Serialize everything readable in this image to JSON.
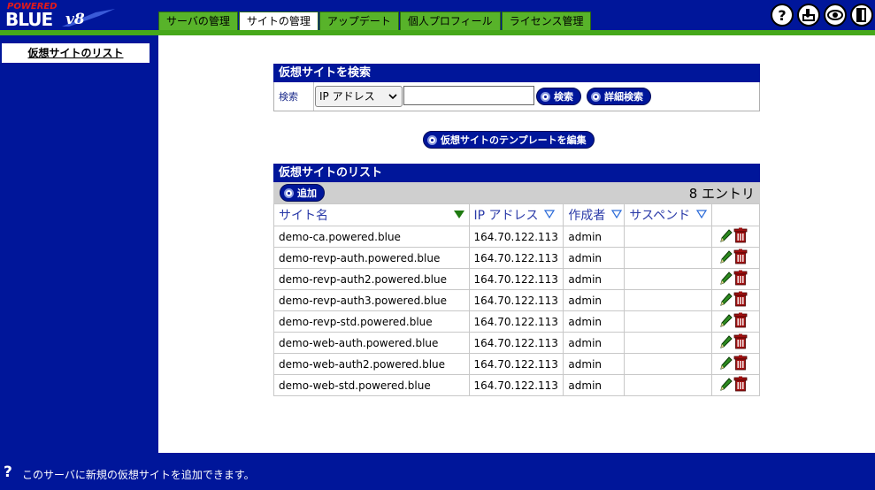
{
  "logo": {
    "powered": "POWERED",
    "blue": "BLUE",
    "version": "v8"
  },
  "tabs": [
    {
      "label": "サーバの管理",
      "active": false
    },
    {
      "label": "サイトの管理",
      "active": true
    },
    {
      "label": "アップデート",
      "active": false
    },
    {
      "label": "個人プロフィール",
      "active": false
    },
    {
      "label": "ライセンス管理",
      "active": false
    }
  ],
  "header_icons": [
    "help-icon",
    "download-icon",
    "view-icon",
    "logout-icon"
  ],
  "sidebar": {
    "items": [
      {
        "label": "仮想サイトのリスト"
      }
    ]
  },
  "search": {
    "title": "仮想サイトを検索",
    "label": "検索",
    "select_value": "IP アドレス",
    "input_value": "",
    "search_button": "検索",
    "advanced_button": "詳細検索"
  },
  "template_button": "仮想サイトのテンプレートを編集",
  "list": {
    "title": "仮想サイトのリスト",
    "add_button": "追加",
    "count_text": "8 エントリ",
    "columns": [
      "サイト名",
      "IP アドレス",
      "作成者",
      "サスペンド"
    ],
    "rows": [
      {
        "site": "demo-ca.powered.blue",
        "ip": "164.70.122.113",
        "creator": "admin",
        "suspend": ""
      },
      {
        "site": "demo-revp-auth.powered.blue",
        "ip": "164.70.122.113",
        "creator": "admin",
        "suspend": ""
      },
      {
        "site": "demo-revp-auth2.powered.blue",
        "ip": "164.70.122.113",
        "creator": "admin",
        "suspend": ""
      },
      {
        "site": "demo-revp-auth3.powered.blue",
        "ip": "164.70.122.113",
        "creator": "admin",
        "suspend": ""
      },
      {
        "site": "demo-revp-std.powered.blue",
        "ip": "164.70.122.113",
        "creator": "admin",
        "suspend": ""
      },
      {
        "site": "demo-web-auth.powered.blue",
        "ip": "164.70.122.113",
        "creator": "admin",
        "suspend": ""
      },
      {
        "site": "demo-web-auth2.powered.blue",
        "ip": "164.70.122.113",
        "creator": "admin",
        "suspend": ""
      },
      {
        "site": "demo-web-std.powered.blue",
        "ip": "164.70.122.113",
        "creator": "admin",
        "suspend": ""
      }
    ]
  },
  "footer": {
    "help_symbol": "?",
    "text": "このサーバに新規の仮想サイトを追加できます。"
  },
  "colors": {
    "primary": "#00169a",
    "tab_green": "#58b32a",
    "stripe_green": "#46a81a",
    "edit_green": "#2e8b20",
    "delete_red": "#a01010"
  }
}
